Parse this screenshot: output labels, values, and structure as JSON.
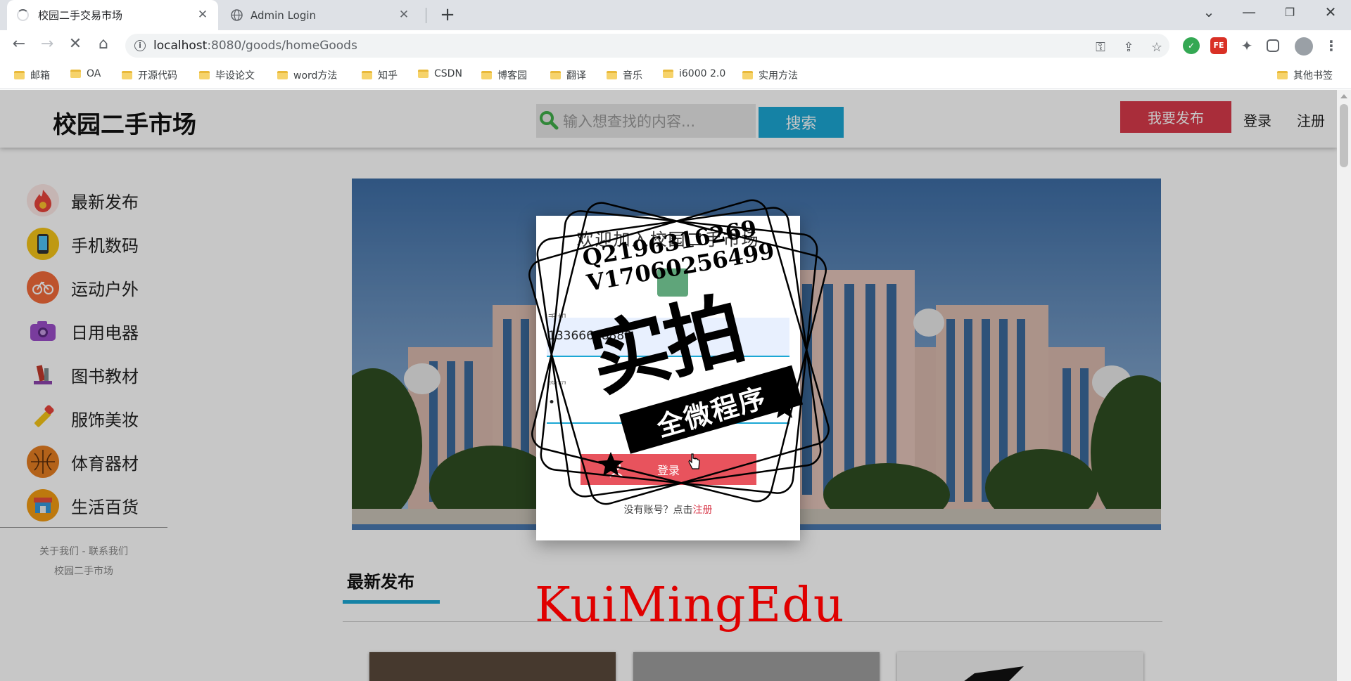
{
  "browser": {
    "tabs": [
      {
        "label": "校园二手交易市场",
        "active": true
      },
      {
        "label": "Admin Login",
        "active": false
      }
    ],
    "url_host": "localhost",
    "url_rest": ":8080/goods/homeGoods",
    "bookmarks": [
      "邮箱",
      "OA",
      "开源代码",
      "毕设论文",
      "word方法",
      "知乎",
      "CSDN",
      "博客园",
      "翻译",
      "音乐",
      "i6000 2.0",
      "实用方法"
    ],
    "other_bookmarks": "其他书签",
    "extensions": [
      {
        "name": "shield-extension-icon",
        "color": "#34a853"
      },
      {
        "name": "fe-extension-icon",
        "color": "#d93025",
        "label": "FE"
      }
    ]
  },
  "site": {
    "logo": "校园二手市场",
    "search_placeholder": "输入想查找的内容...",
    "search_button": "搜索",
    "publish_button": "我要发布",
    "login_link": "登录",
    "register_link": "注册",
    "sidebar": [
      {
        "label": "最新发布",
        "icon": "fire-icon",
        "color": "#e8453c"
      },
      {
        "label": "手机数码",
        "icon": "phone-icon",
        "color": "#f5c518"
      },
      {
        "label": "运动户外",
        "icon": "bicycle-icon",
        "color": "#f26b3a"
      },
      {
        "label": "日用电器",
        "icon": "camera-icon",
        "color": "#9b4dca"
      },
      {
        "label": "图书教材",
        "icon": "books-icon",
        "color": "#c0392b"
      },
      {
        "label": "服饰美妆",
        "icon": "lipstick-icon",
        "color": "#f5c518"
      },
      {
        "label": "体育器材",
        "icon": "basketball-icon",
        "color": "#e67e22"
      },
      {
        "label": "生活百货",
        "icon": "shop-icon",
        "color": "#f39c12"
      }
    ],
    "footer_links": "关于我们 - 联系我们",
    "footer_name": "校园二手市场",
    "section_title": "最新发布"
  },
  "modal": {
    "title": "欢迎加入校园二手市场",
    "phone_label": "手机",
    "phone_value": "13366668888",
    "password_label": "密码",
    "password_value": "•",
    "login_button": "登录",
    "footer_text": "没有账号？点击",
    "register_link": "注册"
  },
  "watermark": {
    "qq": "Q2196316269",
    "wechat": "V17060256499",
    "big_text": "实拍",
    "ribbon_text": "全微程序",
    "brand": "KuiMingEdu"
  },
  "colors": {
    "accent": "#1ba7d4",
    "publish": "#d93a4b",
    "modal_button": "#e8535d"
  }
}
